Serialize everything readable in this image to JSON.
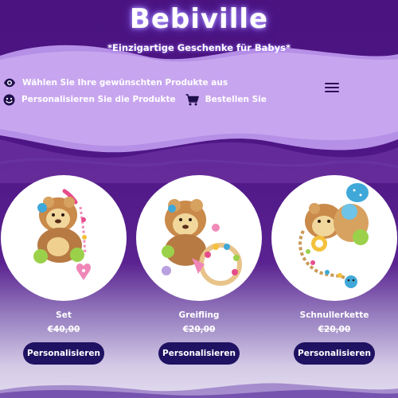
{
  "header": {
    "brand": "Bebiville",
    "tagline": "*Einzigartige Geschenke für Babys*"
  },
  "nav": {
    "items": [
      {
        "label": "Wählen Sie Ihre gewünschten Produkte aus",
        "icon": "eye-icon"
      },
      {
        "label": "Personalisieren Sie die Produkte",
        "icon": "smile-icon"
      },
      {
        "label": "Bestellen Sie",
        "icon": "cart-icon"
      }
    ],
    "menu_icon": "hamburger-menu-icon"
  },
  "products": [
    {
      "name": "Set",
      "price": "€40,00",
      "button": "Personalisieren",
      "image": "lion-plush-set-image"
    },
    {
      "name": "Greifling",
      "price": "€20,00",
      "button": "Personalisieren",
      "image": "lion-plush-rattle-image"
    },
    {
      "name": "Schnullerkette",
      "price": "€20,00",
      "button": "Personalisieren",
      "image": "lion-plush-pacifier-chain-image"
    }
  ],
  "colors": {
    "background_top": "#4a137f",
    "wave": "#c7a4ee",
    "button": "#1f1262",
    "text": "#ffffff"
  }
}
